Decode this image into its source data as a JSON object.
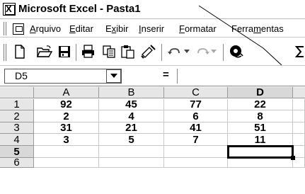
{
  "window": {
    "title": "Microsoft Excel - Pasta1"
  },
  "menu": [
    {
      "label": "Arquivo",
      "accel": "A",
      "rest": "rquivo"
    },
    {
      "label": "Editar",
      "accel": "E",
      "rest": "ditar"
    },
    {
      "label": "Exibir",
      "pre": "E",
      "accel": "x",
      "rest": "ibir"
    },
    {
      "label": "Inserir",
      "accel": "I",
      "rest": "nserir"
    },
    {
      "label": "Formatar",
      "accel": "F",
      "rest": "ormatar"
    },
    {
      "label": "Ferramentas",
      "pre": "Ferra",
      "accel": "m",
      "rest": "entas"
    }
  ],
  "toolbar": [
    "new-document-icon",
    "open-folder-icon",
    "save-icon",
    "print-icon",
    "copy-icon",
    "paste-icon",
    "format-painter-icon",
    "undo-icon",
    "redo-icon",
    "insert-hyperlink-icon",
    "autosum-icon"
  ],
  "formula_bar": {
    "name_box": "D5",
    "equals": "=",
    "content": ""
  },
  "sheet": {
    "columns": [
      "A",
      "B",
      "C",
      "D"
    ],
    "rows": [
      {
        "header": "1",
        "cells": [
          "92",
          "45",
          "77",
          "22"
        ]
      },
      {
        "header": "2",
        "cells": [
          "2",
          "4",
          "6",
          "8"
        ]
      },
      {
        "header": "3",
        "cells": [
          "31",
          "21",
          "41",
          "51"
        ]
      },
      {
        "header": "4",
        "cells": [
          "3",
          "5",
          "7",
          "11"
        ]
      },
      {
        "header": "5",
        "cells": [
          "",
          "",
          "",
          ""
        ]
      },
      {
        "header": "6",
        "cells": [
          "",
          "",
          "",
          ""
        ]
      }
    ],
    "active_cell": "D5"
  }
}
